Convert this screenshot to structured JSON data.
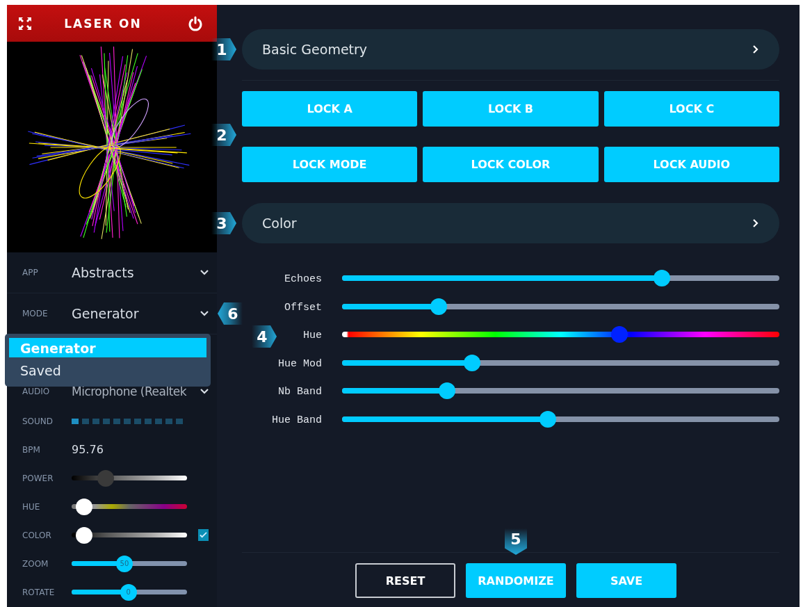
{
  "header": {
    "title": "LASER ON"
  },
  "settings": [
    {
      "kind": "select",
      "label": "APP",
      "value": "Abstracts"
    },
    {
      "kind": "select",
      "label": "MODE",
      "value": "Generator",
      "step": "6",
      "expanded": true,
      "options": [
        {
          "label": "Generator",
          "selected": true
        },
        {
          "label": "Saved",
          "selected": false
        }
      ]
    },
    {
      "kind": "select",
      "label": "AUDIO",
      "value": "Microphone (Realtek"
    },
    {
      "kind": "meter",
      "label": "SOUND"
    },
    {
      "kind": "text",
      "label": "BPM",
      "value": "95.76"
    },
    {
      "kind": "shade",
      "label": "POWER",
      "level": 0.26
    },
    {
      "kind": "spectrum",
      "label": "HUE",
      "level": 0.04
    },
    {
      "kind": "shade",
      "label": "COLOR",
      "level": 0.04,
      "checked": true
    },
    {
      "kind": "range",
      "label": "ZOOM",
      "level": 0.45,
      "thumb_label": "50"
    },
    {
      "kind": "range",
      "label": "ROTATE",
      "level": 0.49,
      "thumb_label": "0"
    }
  ],
  "geometry_panel": {
    "step": "1",
    "title": "Basic Geometry"
  },
  "locks": {
    "step": "2",
    "buttons": [
      "LOCK A",
      "LOCK B",
      "LOCK C",
      "LOCK MODE",
      "LOCK COLOR",
      "LOCK AUDIO"
    ]
  },
  "color_panel": {
    "step": "3",
    "title": "Color"
  },
  "color_sliders": {
    "step": "4",
    "items": [
      {
        "label": "Echoes",
        "kind": "plain",
        "level": 0.74
      },
      {
        "label": "Offset",
        "kind": "plain",
        "level": 0.21
      },
      {
        "label": "Hue",
        "kind": "rainbow",
        "level": 0.64
      },
      {
        "label": "Hue Mod",
        "kind": "plain",
        "level": 0.29
      },
      {
        "label": "Nb Band",
        "kind": "plain",
        "level": 0.23
      },
      {
        "label": "Hue Band",
        "kind": "plain",
        "level": 0.47
      }
    ]
  },
  "actions": {
    "step": "5",
    "buttons": [
      {
        "label": "RESET",
        "kind": "outline"
      },
      {
        "label": "RANDOMIZE",
        "kind": "filled"
      },
      {
        "label": "SAVE",
        "kind": "filled"
      }
    ]
  }
}
